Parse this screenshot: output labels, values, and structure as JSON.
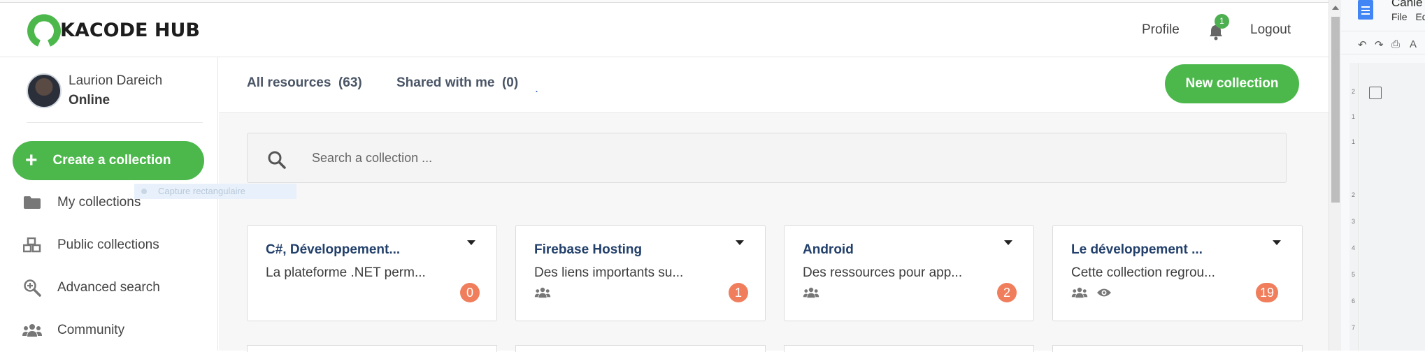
{
  "header": {
    "brand": "KACODE HUB",
    "nav": {
      "profile": "Profile",
      "notifications_count": "1",
      "logout": "Logout"
    }
  },
  "sidebar": {
    "user": {
      "name": "Laurion Dareich",
      "status": "Online"
    },
    "create_button": "Create a collection",
    "items": [
      {
        "label": "My collections",
        "icon": "folder-icon"
      },
      {
        "label": "Public collections",
        "icon": "cubes-icon"
      },
      {
        "label": "Advanced search",
        "icon": "zoom-in-icon"
      },
      {
        "label": "Community",
        "icon": "users-icon"
      }
    ],
    "tooltip_ghost": "Capture rectangulaire"
  },
  "main": {
    "tabs": [
      {
        "label": "All resources",
        "count": "(63)"
      },
      {
        "label": "Shared with me",
        "count": "(0)"
      }
    ],
    "tab_dot": ".",
    "new_collection_button": "New collection",
    "search": {
      "placeholder": "Search a collection ...",
      "value": ""
    },
    "cards": [
      {
        "title": "C#, Développement...",
        "description": "La plateforme .NET perm...",
        "count": "0",
        "icons": []
      },
      {
        "title": "Firebase Hosting",
        "description": "Des liens importants su...",
        "count": "1",
        "icons": [
          "users-icon"
        ]
      },
      {
        "title": "Android",
        "description": "Des ressources pour app...",
        "count": "2",
        "icons": [
          "users-icon"
        ]
      },
      {
        "title": "Le développement ...",
        "description": "Cette collection regrou...",
        "count": "19",
        "icons": [
          "users-icon",
          "eye-icon"
        ]
      }
    ]
  },
  "docs_pane": {
    "title": "Cahie",
    "menu": "File Ed",
    "toolbar_partial": "A",
    "ruler": [
      "2",
      "1",
      "1",
      "2",
      "3",
      "4",
      "5",
      "6",
      "7"
    ]
  },
  "colors": {
    "brand_green": "#4cb84c",
    "badge": "#f07e5c",
    "title_blue": "#22406b"
  }
}
